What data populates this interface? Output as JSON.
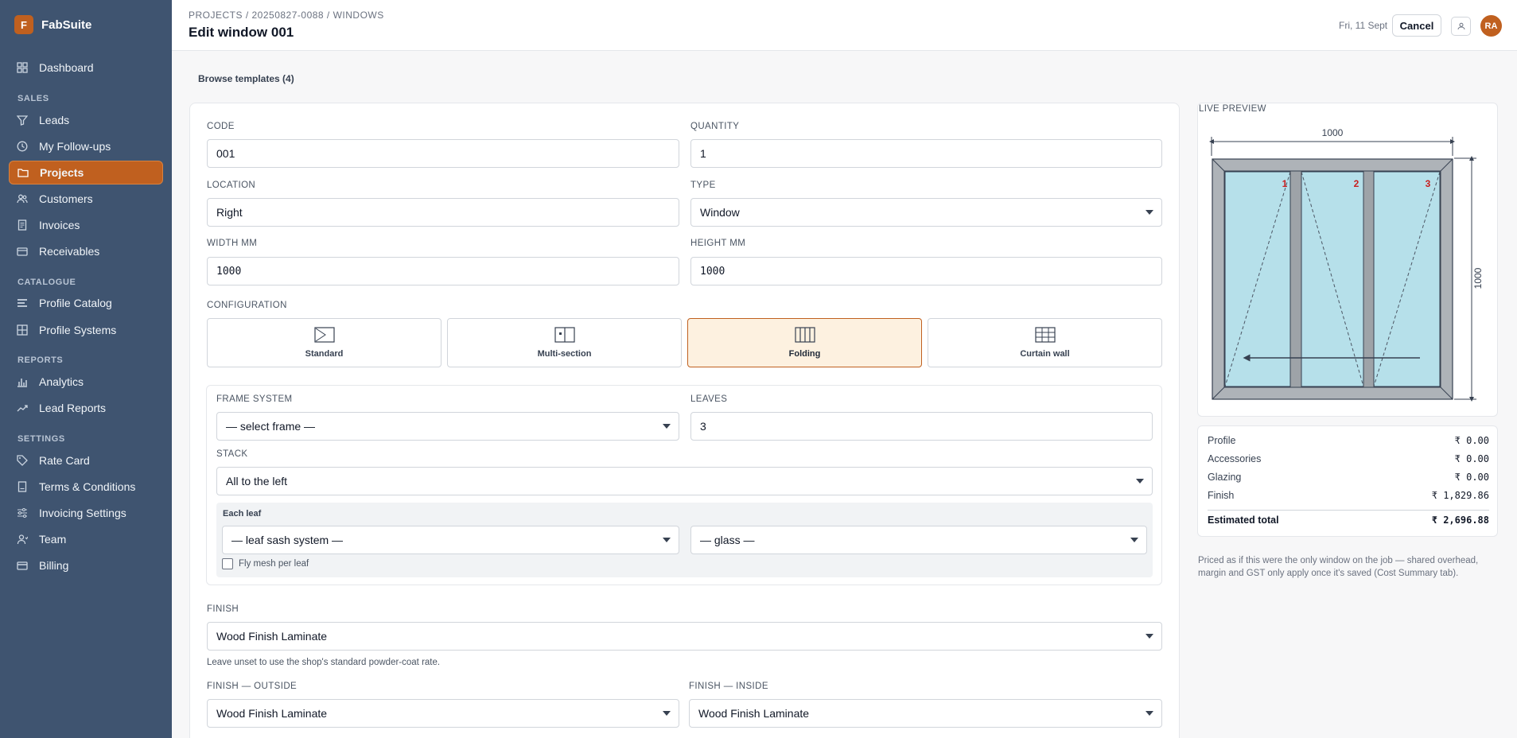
{
  "brand": {
    "logo_letter": "F",
    "name": "FabSuite"
  },
  "sidebar": {
    "dashboard": "Dashboard",
    "sections": [
      "SALES",
      "CATALOGUE",
      "REPORTS",
      "SETTINGS"
    ],
    "items": [
      {
        "label": "Leads",
        "icon": "filter-icon"
      },
      {
        "label": "My Follow-ups",
        "icon": "clock-icon"
      },
      {
        "label": "Projects",
        "icon": "folder-icon",
        "active": true
      },
      {
        "label": "Customers",
        "icon": "users-icon"
      },
      {
        "label": "Invoices",
        "icon": "document-icon"
      },
      {
        "label": "Receivables",
        "icon": "wallet-icon"
      },
      {
        "label": "Profile Catalog",
        "icon": "layers-icon"
      },
      {
        "label": "Profile Systems",
        "icon": "grid-icon"
      },
      {
        "label": "Analytics",
        "icon": "bar-chart-icon"
      },
      {
        "label": "Lead Reports",
        "icon": "trend-icon"
      },
      {
        "label": "Rate Card",
        "icon": "tag-icon"
      },
      {
        "label": "Terms & Conditions",
        "icon": "document-icon"
      },
      {
        "label": "Invoicing Settings",
        "icon": "sliders-icon"
      },
      {
        "label": "Team",
        "icon": "user-icon"
      },
      {
        "label": "Billing",
        "icon": "card-icon"
      }
    ]
  },
  "header": {
    "breadcrumb": "PROJECTS / 20250827-0088 / WINDOWS",
    "title": "Edit window 001",
    "date": "Fri, 11 Sept",
    "cancel": "Cancel",
    "avatar": "RA"
  },
  "browse_templates": "Browse templates (4)",
  "form": {
    "code_label": "CODE",
    "code": "001",
    "quantity_label": "QUANTITY",
    "quantity": "1",
    "location_label": "LOCATION",
    "location": "Right",
    "type_label": "TYPE",
    "type": "Window",
    "width_label": "WIDTH MM",
    "width": "1000",
    "height_label": "HEIGHT MM",
    "height": "1000",
    "configuration_label": "CONFIGURATION",
    "configurations": [
      "Standard",
      "Multi-section",
      "Folding",
      "Curtain wall"
    ],
    "selected_configuration": "Folding",
    "frame_system_label": "FRAME SYSTEM",
    "frame_system": "— select frame —",
    "leaves_label": "LEAVES",
    "leaves": "3",
    "stack_label": "STACK",
    "stack": "All to the left",
    "each_leaf_label": "Each leaf",
    "leaf_sash": "— leaf sash system —",
    "glass": "— glass —",
    "fly_mesh_label": "Fly mesh per leaf",
    "fly_mesh_checked": false,
    "finish_label": "FINISH",
    "finish": "Wood Finish Laminate",
    "finish_hint": "Leave unset to use the shop's standard powder-coat rate.",
    "finish_outside_label": "FINISH — OUTSIDE",
    "finish_outside": "Wood Finish Laminate",
    "finish_inside_label": "FINISH — INSIDE",
    "finish_inside": "Wood Finish Laminate"
  },
  "preview": {
    "title": "LIVE PREVIEW",
    "width_dim": "1000",
    "height_dim": "1000",
    "leaf_numbers": [
      "1",
      "2",
      "3"
    ],
    "colors": {
      "frame": "#aeb3b8",
      "glass": "#b6e0ea",
      "leaf_number": "#c81e1e"
    }
  },
  "pricing": {
    "rows": [
      {
        "label": "Profile",
        "value": "₹ 0.00"
      },
      {
        "label": "Accessories",
        "value": "₹ 0.00"
      },
      {
        "label": "Glazing",
        "value": "₹ 0.00"
      },
      {
        "label": "Finish",
        "value": "₹ 1,829.86"
      }
    ],
    "total_label": "Estimated total",
    "total_value": "₹ 2,696.88",
    "note": "Priced as if this were the only window on the job — shared overhead, margin and GST only apply once it's saved (Cost Summary tab)."
  },
  "colors": {
    "accent": "#c0601f",
    "sidebar": "#3f5470"
  }
}
